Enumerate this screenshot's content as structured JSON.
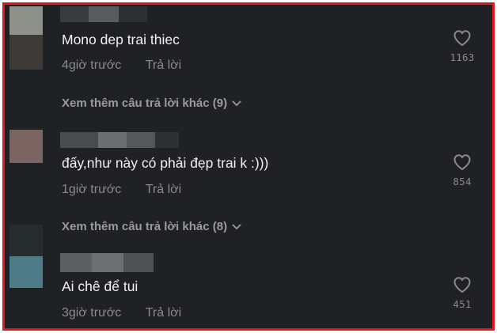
{
  "comments": [
    {
      "text": "Mono dep trai thiec",
      "time": "4giờ trước",
      "reply_label": "Trả lời",
      "likes": "1163",
      "more_replies": "Xem thêm câu trả lời khác (9)"
    },
    {
      "text": "đấy,như này có phải đẹp trai k :)))",
      "time": "1giờ trước",
      "reply_label": "Trả lời",
      "likes": "854",
      "more_replies": "Xem thêm câu trả lời khác (8)"
    },
    {
      "text": "Ai chê để tui",
      "time": "3giờ trước",
      "reply_label": "Trả lời",
      "likes": "451"
    }
  ],
  "icons": {
    "like": "heart-icon",
    "expand": "chevron-down-icon"
  },
  "colors": {
    "border": "#e8141c",
    "background": "#202124",
    "text": "#f1f1f1",
    "muted": "#8a8b8f"
  }
}
